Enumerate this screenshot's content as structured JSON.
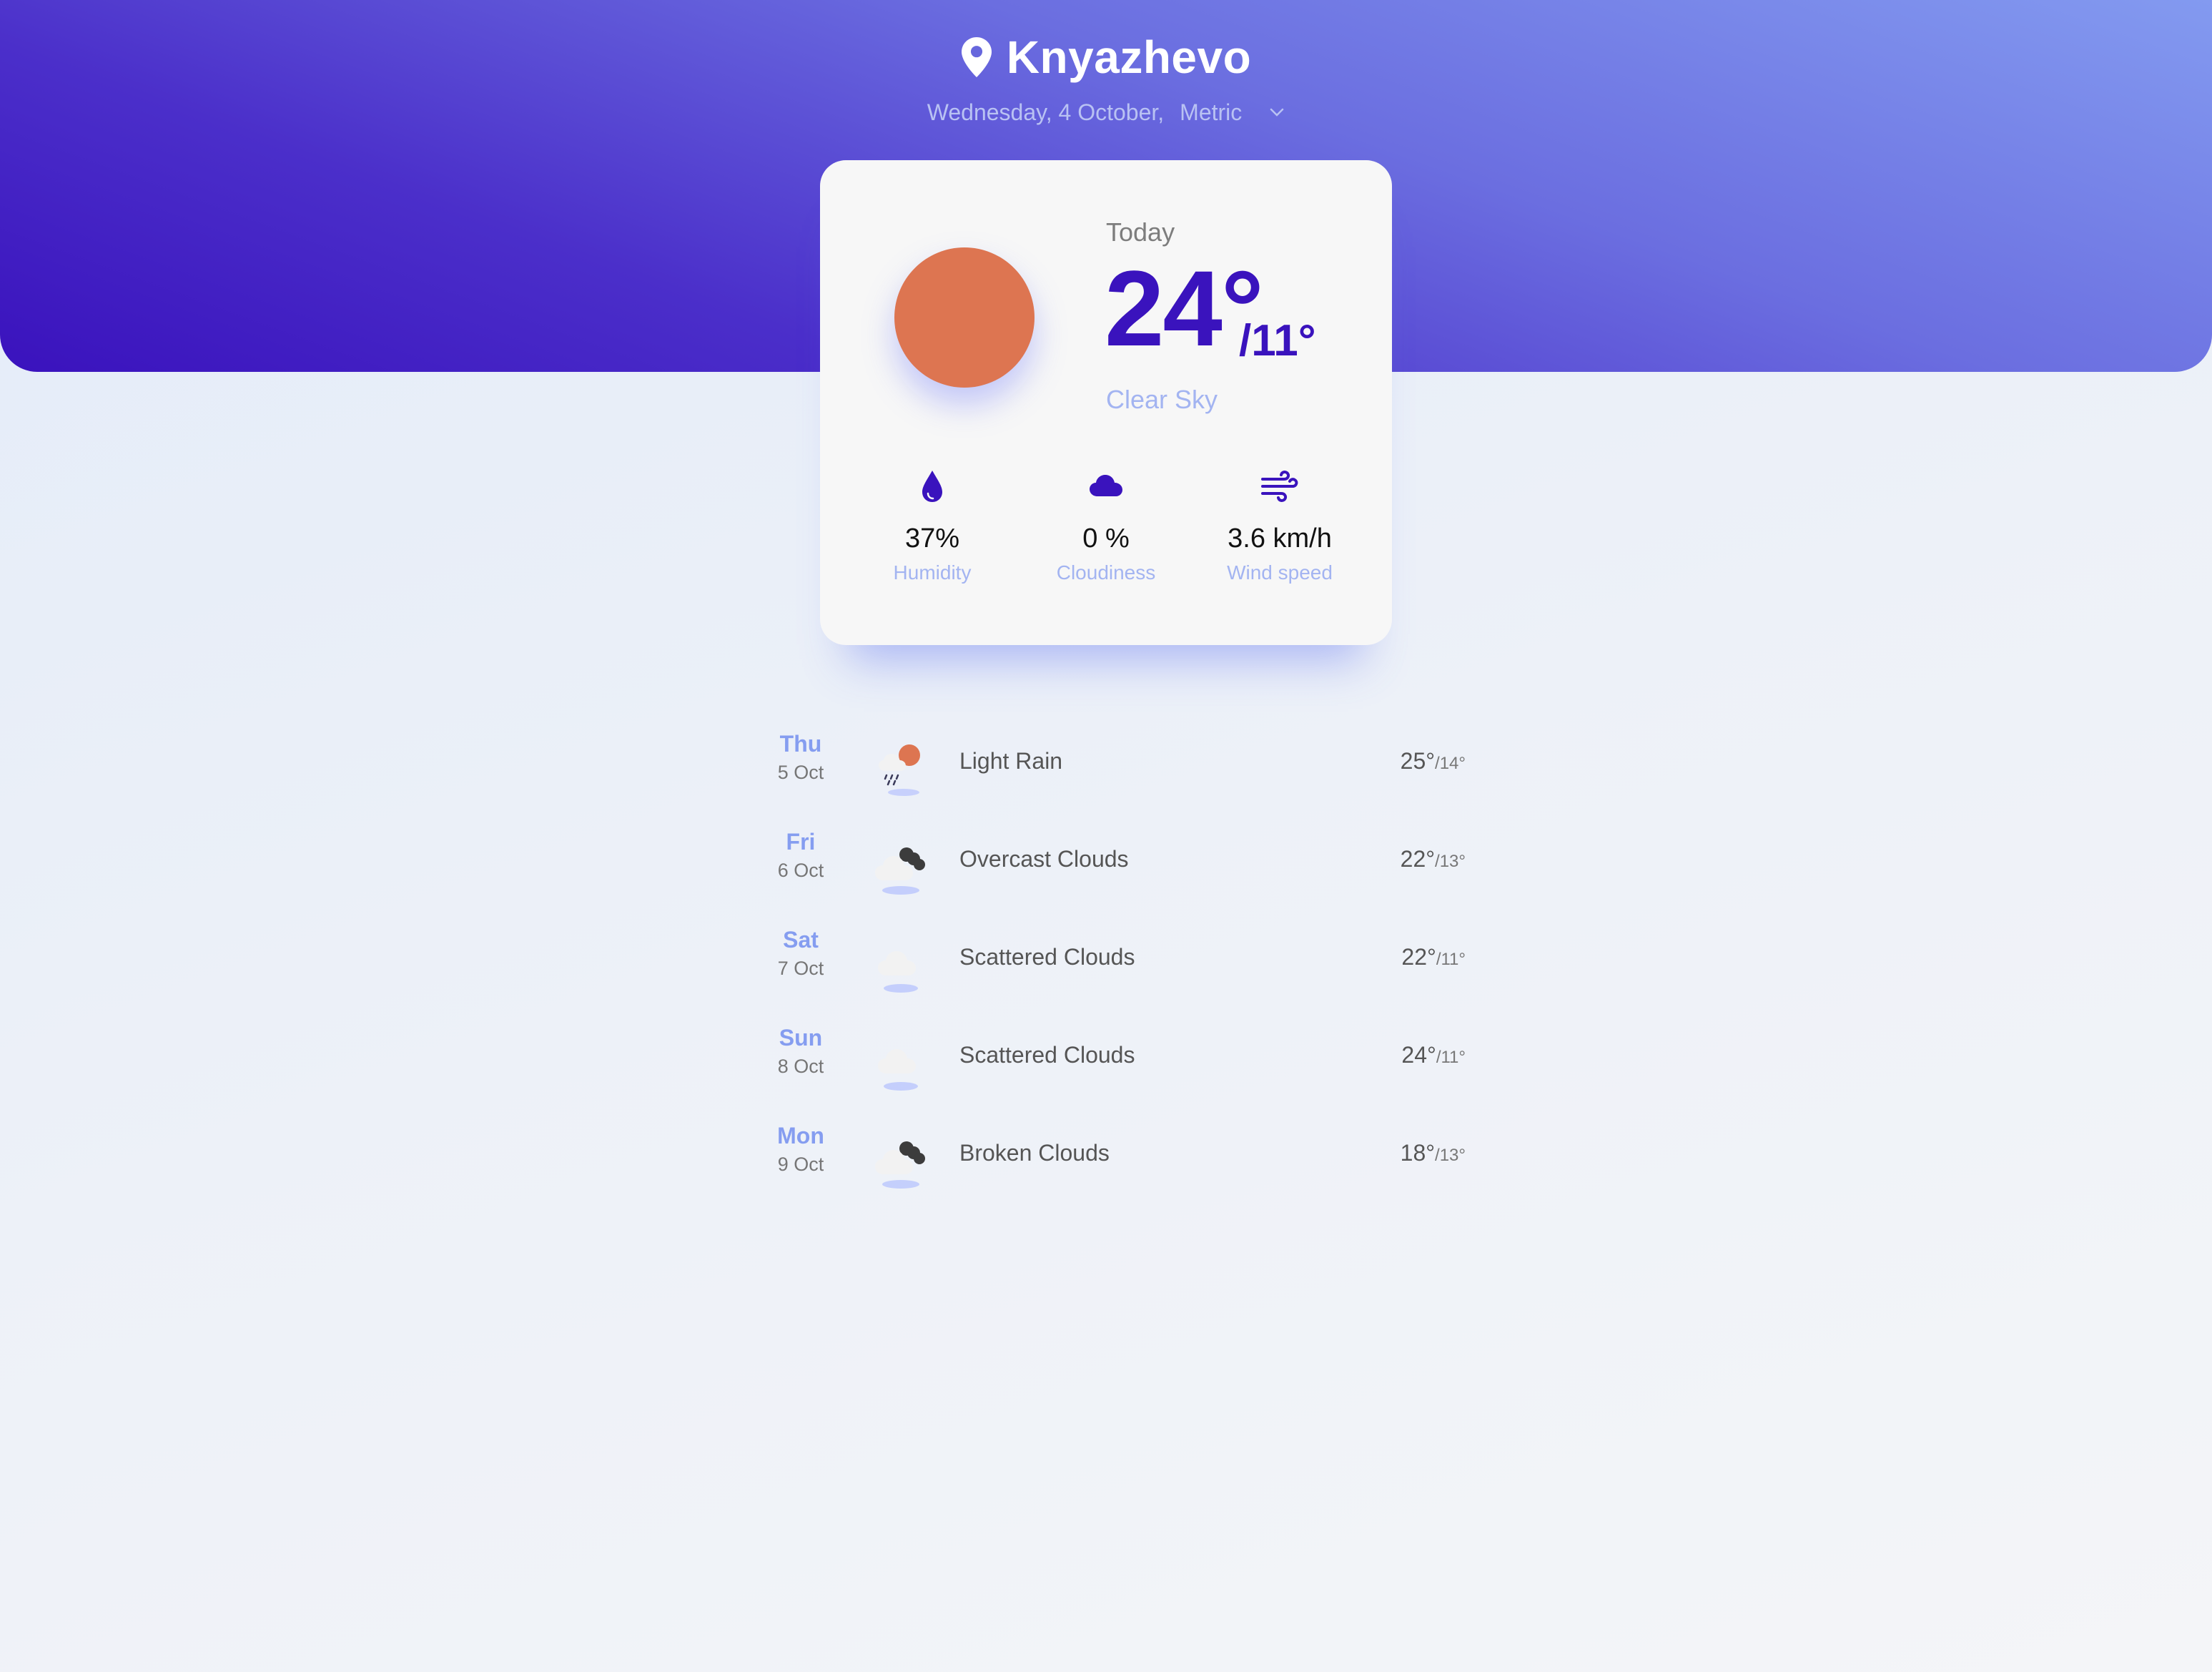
{
  "header": {
    "city": "Knyazhevo",
    "date": "Wednesday, 4 October,",
    "unit": "Metric",
    "pin_icon": "map-pin-icon",
    "gradient_top_right": "#839af0",
    "gradient_bottom_left": "#3a12bd"
  },
  "today": {
    "label": "Today",
    "temp_high": "24°",
    "temp_low": "/11°",
    "condition": "Clear Sky",
    "icon": "sun-icon",
    "sun_color": "#dd7551",
    "accent_color": "#3a13bd",
    "stats": [
      {
        "icon": "water-drop-icon",
        "value": "37%",
        "label": "Humidity"
      },
      {
        "icon": "cloud-icon",
        "value": "0 %",
        "label": "Cloudiness"
      },
      {
        "icon": "wind-icon",
        "value": "3.6 km/h",
        "label": "Wind speed"
      }
    ]
  },
  "forecast": [
    {
      "day": "Thu",
      "date": "5 Oct",
      "icon": "light-rain-icon",
      "desc": "Light Rain",
      "high": "25°",
      "low": "/14°"
    },
    {
      "day": "Fri",
      "date": "6 Oct",
      "icon": "overcast-clouds-icon",
      "desc": "Overcast Clouds",
      "high": "22°",
      "low": "/13°"
    },
    {
      "day": "Sat",
      "date": "7 Oct",
      "icon": "scattered-clouds-icon",
      "desc": "Scattered Clouds",
      "high": "22°",
      "low": "/11°"
    },
    {
      "day": "Sun",
      "date": "8 Oct",
      "icon": "scattered-clouds-icon",
      "desc": "Scattered Clouds",
      "high": "24°",
      "low": "/11°"
    },
    {
      "day": "Mon",
      "date": "9 Oct",
      "icon": "broken-clouds-icon",
      "desc": "Broken Clouds",
      "high": "18°",
      "low": "/13°"
    }
  ]
}
